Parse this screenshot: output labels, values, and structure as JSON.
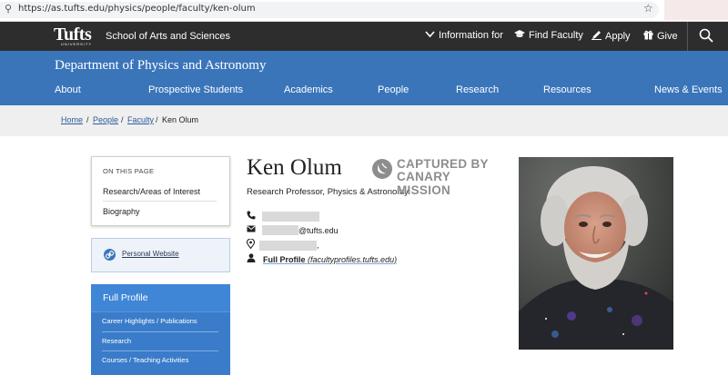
{
  "browser": {
    "url": "https://as.tufts.edu/physics/people/faculty/ken-olum"
  },
  "topbar": {
    "logo_word": "Tufts",
    "logo_sub": "UNIVERSITY",
    "school": "School of Arts and Sciences",
    "links": [
      "Information for",
      "Find Faculty",
      "Apply",
      "Give"
    ]
  },
  "dept": {
    "name": "Department of Physics and Astronomy",
    "nav": [
      "About",
      "Prospective Students",
      "Academics",
      "People",
      "Research",
      "Resources",
      "News & Events"
    ]
  },
  "breadcrumb": {
    "items": [
      "Home",
      "People",
      "Faculty"
    ],
    "current": "Ken Olum"
  },
  "sidebar": {
    "on_this_page": "ON THIS PAGE",
    "links": [
      "Research/Areas of Interest",
      "Biography"
    ],
    "website": "Personal Website",
    "full_profile": "Full Profile",
    "sub_links": [
      "Career Highlights / Publications",
      "Research",
      "Courses / Teaching Activities"
    ]
  },
  "profile": {
    "name": "Ken Olum",
    "title": "Research Professor, Physics & Astronomy",
    "email_suffix": "@tufts.edu",
    "address_suffix": ",",
    "full_profile_label": "Full Profile",
    "full_profile_source": "(facultyprofiles.tufts.edu)"
  },
  "watermark": {
    "line1": "CAPTURED BY",
    "line2": "CANARY MISSION"
  },
  "colors": {
    "topbar": "#2d2d2d",
    "brand_blue": "#3a75ba",
    "sidebar_blue": "#3f86d6"
  }
}
